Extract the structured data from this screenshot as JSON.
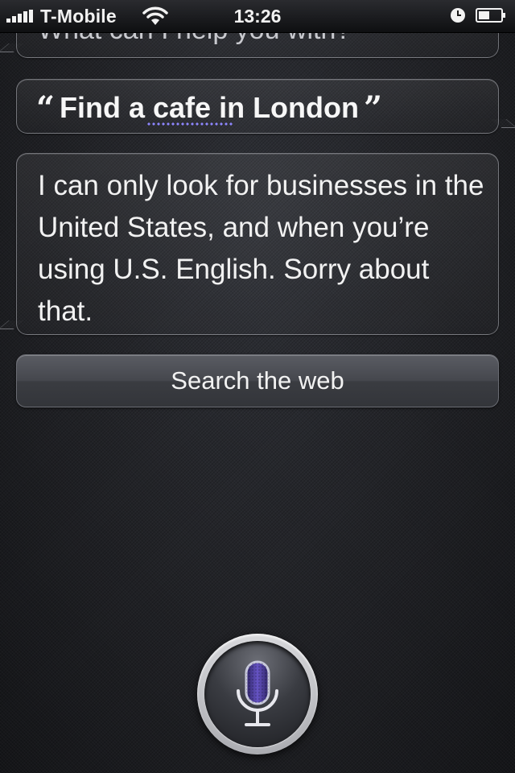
{
  "status_bar": {
    "carrier": "T-Mobile",
    "time": "13:26"
  },
  "conversation": {
    "prompt": "What can I help you with?",
    "query_open_quote": "“",
    "query": "Find a cafe in London",
    "query_close_quote": "”",
    "answer": "I can only look for businesses in the United States, and when you’re using U.S. English. Sorry about that."
  },
  "actions": {
    "search_web_label": "Search the web"
  },
  "colors": {
    "accent_underline": "#8e86ff",
    "mic_purple": "#4a3b9a"
  },
  "icons": {
    "signal": "signal-bars-icon",
    "wifi": "wifi-icon",
    "alarm": "alarm-clock-icon",
    "battery": "battery-icon",
    "mic": "microphone-icon"
  }
}
